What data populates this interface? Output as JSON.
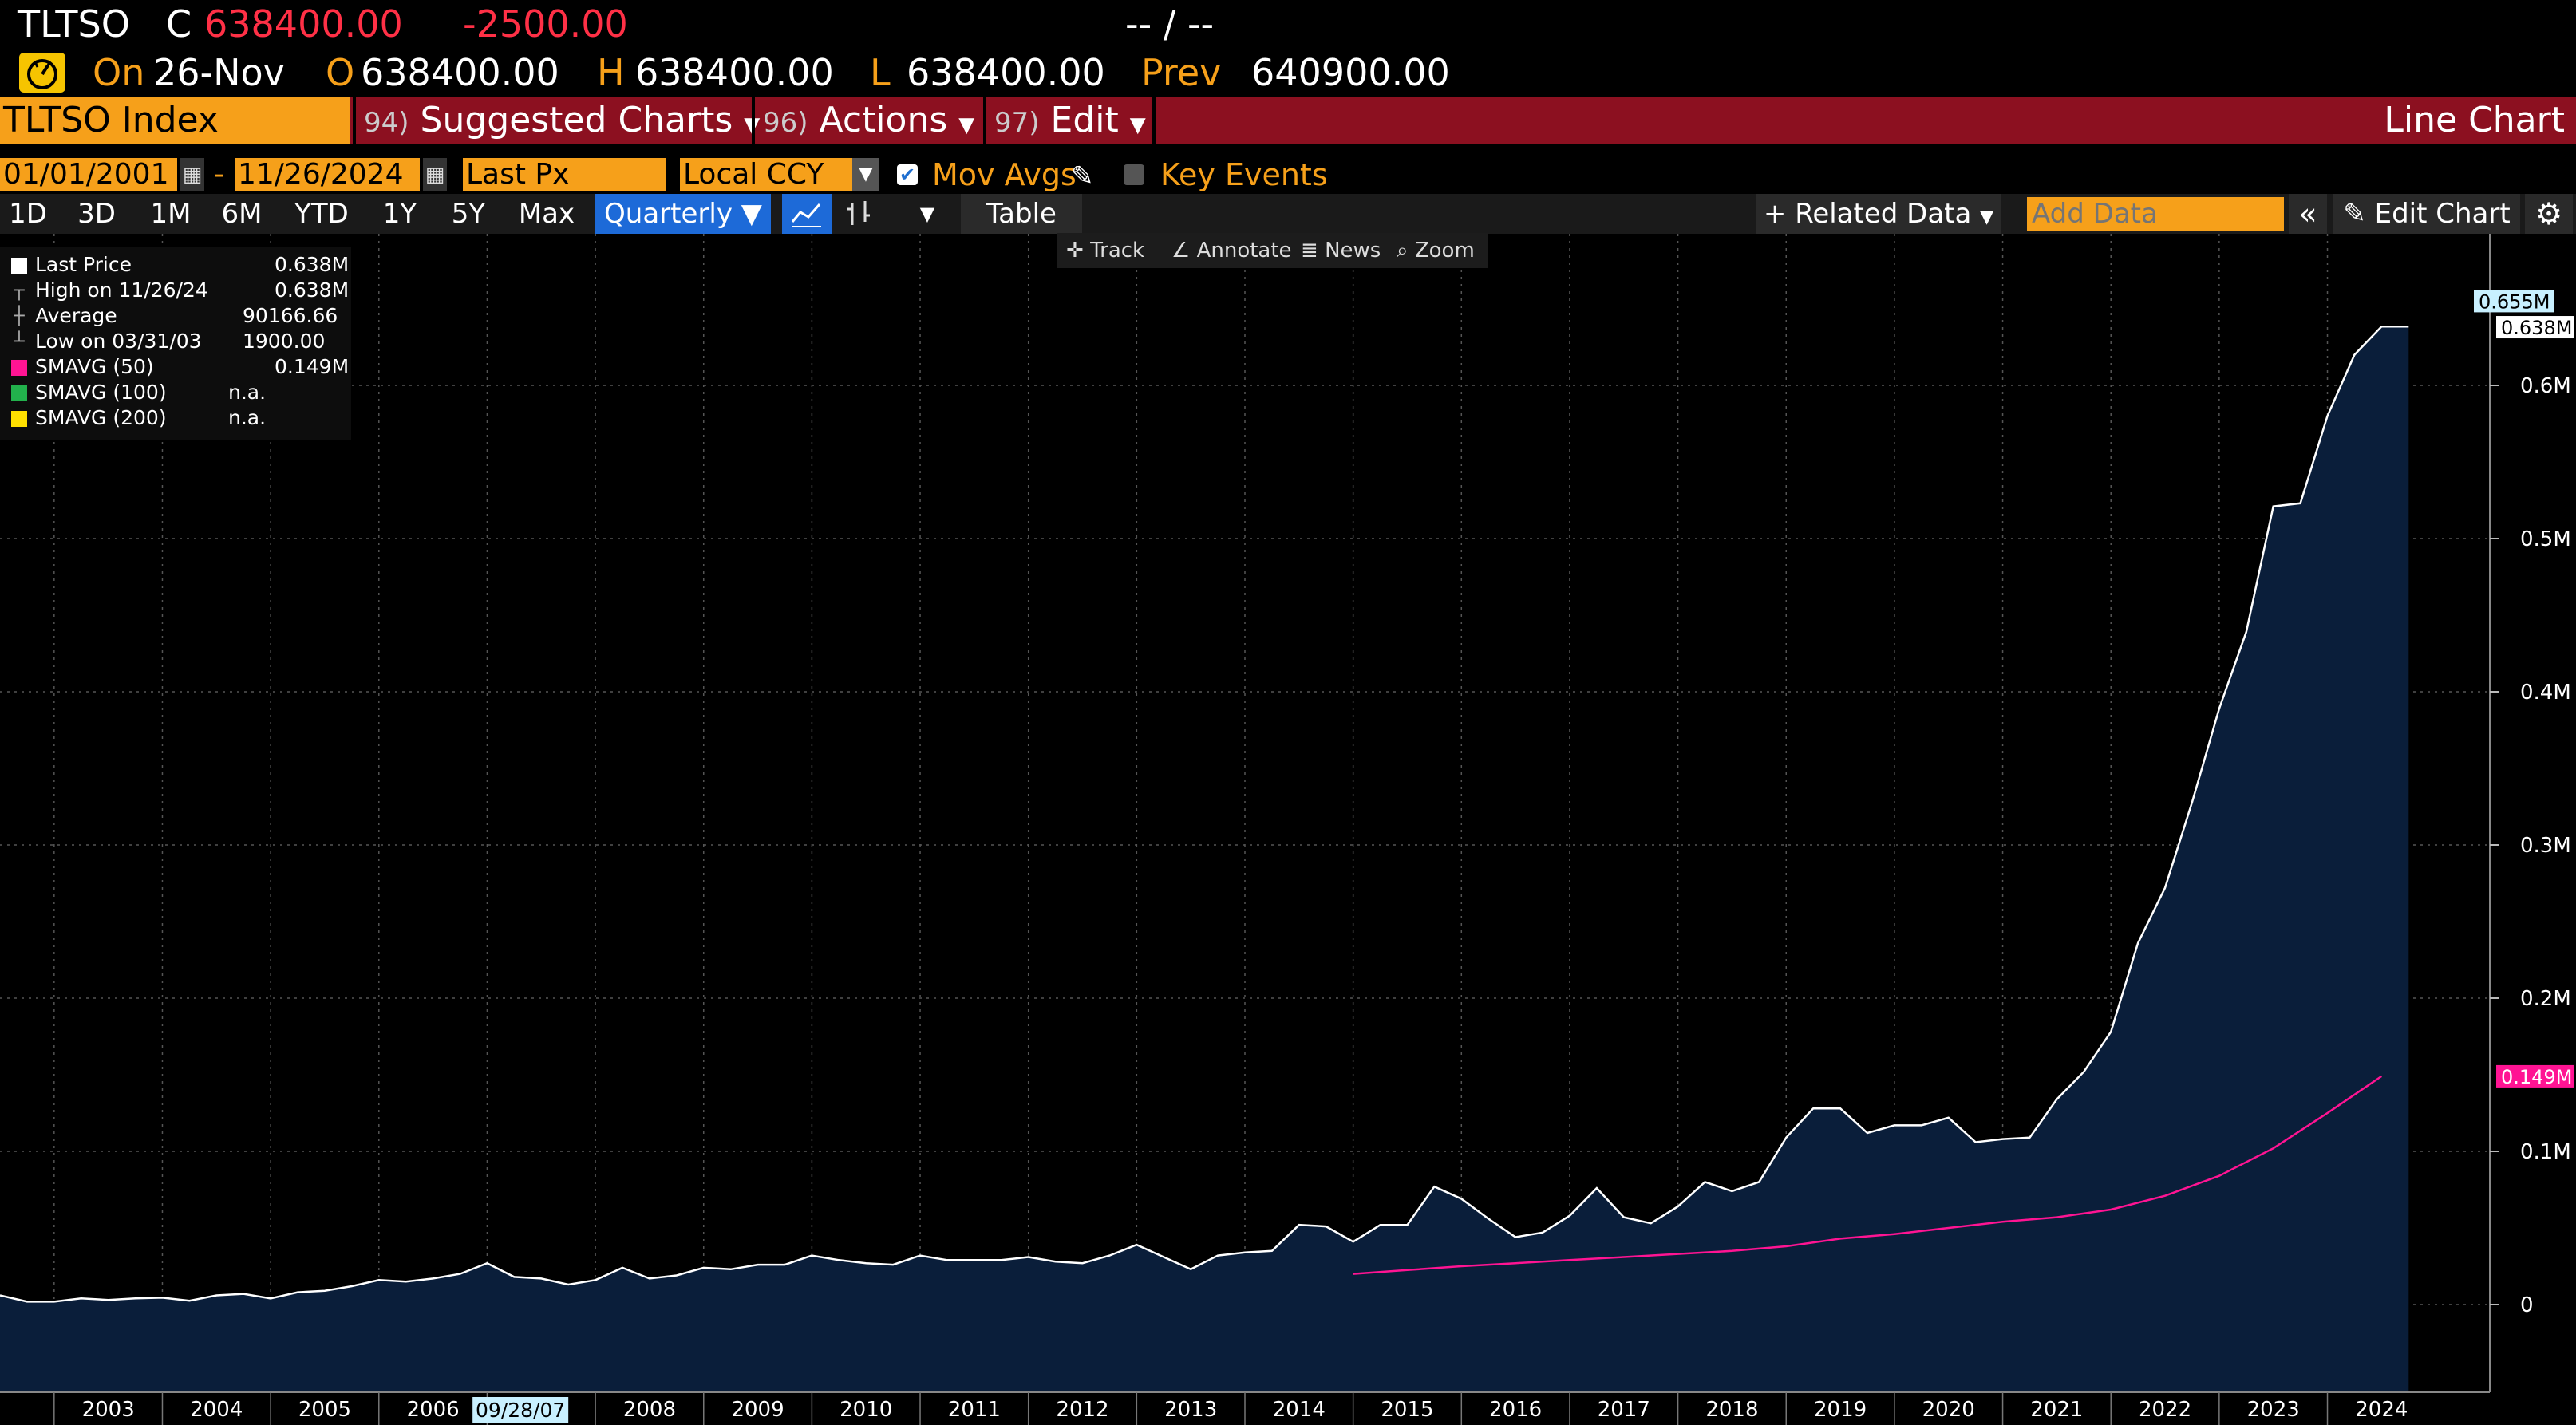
{
  "header": {
    "ticker": "TLTSO",
    "close_label": "C",
    "close_value": "638400.00",
    "change": "-2500.00",
    "bidask": "-- / --",
    "on_label": "On",
    "date": "26-Nov",
    "open_label": "O",
    "open_value": "638400.00",
    "high_label": "H",
    "high_value": "638400.00",
    "low_label": "L",
    "low_value": "638400.00",
    "prev_label": "Prev",
    "prev_value": "640900.00"
  },
  "menu": {
    "security": "TLTSO Index",
    "suggested_num": "94)",
    "suggested": "Suggested Charts",
    "actions_num": "96)",
    "actions": "Actions",
    "edit_num": "97)",
    "edit": "Edit",
    "chart_type": "Line Chart"
  },
  "controls": {
    "start_date": "01/01/2001",
    "dash": "-",
    "end_date": "11/26/2024",
    "field": "Last Px",
    "currency": "Local CCY",
    "mov_avgs": "Mov Avgs",
    "key_events": "Key Events",
    "periods": [
      "1D",
      "3D",
      "1M",
      "6M",
      "YTD",
      "1Y",
      "5Y",
      "Max"
    ],
    "frequency": "Quarterly",
    "table": "Table",
    "related_data": "Related Data",
    "add_data_placeholder": "Add Data",
    "edit_chart": "Edit Chart",
    "mini": {
      "track": "Track",
      "annotate": "Annotate",
      "news": "News",
      "zoom": "Zoom"
    }
  },
  "legend": [
    {
      "label": "Last Price",
      "value": "0.638M",
      "color": "#ffffff"
    },
    {
      "label": "High on 11/26/24",
      "value": "0.638M",
      "color": ""
    },
    {
      "label": "Average",
      "value": "90166.66",
      "color": ""
    },
    {
      "label": "Low on 03/31/03",
      "value": "1900.00",
      "color": ""
    },
    {
      "label": "SMAVG (50)",
      "value": "0.149M",
      "color": "#ff1493"
    },
    {
      "label": "SMAVG (100)",
      "value": "n.a.",
      "color": "#22b14c"
    },
    {
      "label": "SMAVG (200)",
      "value": "n.a.",
      "color": "#ffe000"
    }
  ],
  "chart_data": {
    "type": "area",
    "ylim": [
      -55000,
      700000
    ],
    "y_ticks": [
      0,
      100000,
      200000,
      300000,
      400000,
      500000,
      600000
    ],
    "y_tick_labels": [
      "0",
      "0.1M",
      "0.2M",
      "0.3M",
      "0.4M",
      "0.5M",
      "0.6M"
    ],
    "x_tick_labels": [
      "2003",
      "2004",
      "2005",
      "2006",
      "2007",
      "2008",
      "2009",
      "2010",
      "2011",
      "2012",
      "2013",
      "2014",
      "2015",
      "2016",
      "2017",
      "2018",
      "2019",
      "2020",
      "2021",
      "2022",
      "2023",
      "2024"
    ],
    "x_start_year": 2002.5,
    "x_end_year": 2025.5,
    "cursor_date_label": "09/28/07",
    "cursor_year": 2007.75,
    "grid": true,
    "value_labels": [
      {
        "text": "0.655M",
        "value": 655000,
        "color": "#c8f0ff",
        "fg": "#000"
      },
      {
        "text": "0.638M",
        "value": 638000,
        "color": "#ffffff",
        "fg": "#000"
      },
      {
        "text": "0.149M",
        "value": 149000,
        "color": "#ff1493",
        "fg": "#fff"
      }
    ],
    "series": [
      {
        "name": "Last Price",
        "color": "#ffffff",
        "fill": "#0a1e3a",
        "x": [
          2002.5,
          2002.75,
          2003.0,
          2003.25,
          2003.5,
          2003.75,
          2004.0,
          2004.25,
          2004.5,
          2004.75,
          2005.0,
          2005.25,
          2005.5,
          2005.75,
          2006.0,
          2006.25,
          2006.5,
          2006.75,
          2007.0,
          2007.25,
          2007.5,
          2007.75,
          2008.0,
          2008.25,
          2008.5,
          2008.75,
          2009.0,
          2009.25,
          2009.5,
          2009.75,
          2010.0,
          2010.25,
          2010.5,
          2010.75,
          2011.0,
          2011.25,
          2011.5,
          2011.75,
          2012.0,
          2012.25,
          2012.5,
          2012.75,
          2013.0,
          2013.25,
          2013.5,
          2013.75,
          2014.0,
          2014.25,
          2014.5,
          2014.75,
          2015.0,
          2015.25,
          2015.5,
          2015.75,
          2016.0,
          2016.25,
          2016.5,
          2016.75,
          2017.0,
          2017.25,
          2017.5,
          2017.75,
          2018.0,
          2018.25,
          2018.5,
          2018.75,
          2019.0,
          2019.25,
          2019.5,
          2019.75,
          2020.0,
          2020.25,
          2020.5,
          2020.75,
          2021.0,
          2021.25,
          2021.5,
          2021.75,
          2022.0,
          2022.25,
          2022.5,
          2022.75,
          2023.0,
          2023.25,
          2023.5,
          2023.75,
          2024.0,
          2024.25,
          2024.5,
          2024.75
        ],
        "values": [
          6000,
          1900,
          1900,
          4000,
          3000,
          4000,
          4500,
          2500,
          6000,
          7000,
          4000,
          8000,
          9000,
          12000,
          16000,
          15000,
          17000,
          20000,
          27000,
          18000,
          17000,
          13000,
          16000,
          24000,
          17000,
          19000,
          24000,
          23000,
          26000,
          26000,
          32000,
          29000,
          27000,
          26000,
          32000,
          29000,
          29000,
          29000,
          31000,
          28000,
          27000,
          32000,
          39000,
          31000,
          23000,
          32000,
          34000,
          35000,
          52000,
          51000,
          41000,
          52000,
          52000,
          77000,
          69000,
          56000,
          44000,
          47000,
          58000,
          76000,
          57000,
          53000,
          64000,
          80000,
          74000,
          80000,
          109000,
          128000,
          128000,
          112000,
          117000,
          117000,
          122000,
          106000,
          108000,
          109000,
          134000,
          152000,
          178000,
          236000,
          272000,
          328000,
          389000,
          439000,
          521000,
          523000,
          580000,
          620000,
          638400,
          638400
        ]
      },
      {
        "name": "SMAVG (50)",
        "color": "#ff1493",
        "x": [
          2015.0,
          2015.5,
          2016.0,
          2016.5,
          2017.0,
          2017.5,
          2018.0,
          2018.5,
          2019.0,
          2019.5,
          2020.0,
          2020.5,
          2021.0,
          2021.5,
          2022.0,
          2022.5,
          2023.0,
          2023.5,
          2024.0,
          2024.5
        ],
        "values": [
          20000,
          22500,
          25000,
          27000,
          29000,
          31000,
          33000,
          35000,
          38000,
          43000,
          46000,
          50000,
          54000,
          57000,
          62000,
          71000,
          84000,
          102000,
          125000,
          149000
        ]
      }
    ]
  }
}
